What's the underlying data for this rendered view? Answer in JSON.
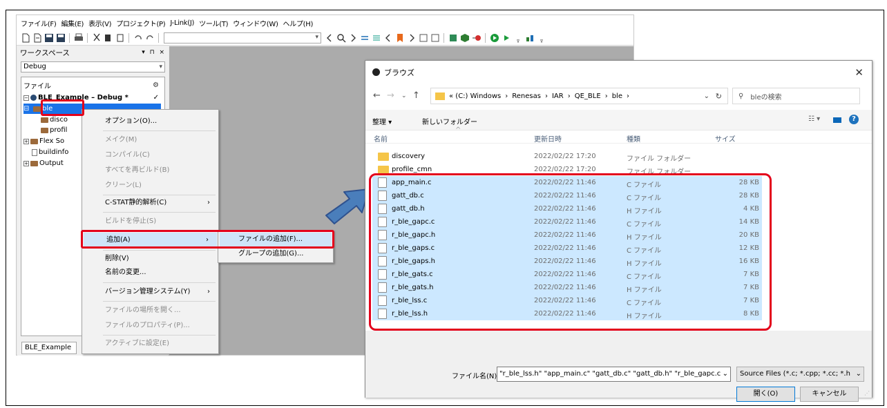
{
  "ide": {
    "menu": [
      "ファイル(F)",
      "編集(E)",
      "表示(V)",
      "プロジェクト(P)",
      "J-Link(J)",
      "ツール(T)",
      "ウィンドウ(W)",
      "ヘルプ(H)"
    ],
    "workspace": {
      "title": "ワークスペース",
      "pin_controls": "▾ ⊓ ×",
      "config": "Debug",
      "tree_header": "ファイル",
      "project": "BLE_Example – Debug *",
      "nodes": [
        "ble",
        "disco",
        "profil",
        "Flex So",
        "buildinfo",
        "Output"
      ],
      "tab": "BLE_Example"
    }
  },
  "context_menu": {
    "items": [
      "オプション(O)...",
      "メイク(M)",
      "コンパイル(C)",
      "すべてを再ビルド(B)",
      "クリーン(L)",
      "C-STAT静的解析(C)",
      "ビルドを停止(S)",
      "追加(A)",
      "削除(V)",
      "名前の変更...",
      "バージョン管理システム(Y)",
      "ファイルの場所を開く...",
      "ファイルのプロパティ(P)...",
      "アクティブに設定(E)"
    ],
    "submenu": [
      "ファイルの追加(F)...",
      "グループの追加(G)..."
    ]
  },
  "dialog": {
    "title": "ブラウズ",
    "path": [
      "« (C:) Windows",
      "Renesas",
      "IAR",
      "QE_BLE",
      "ble"
    ],
    "search_placeholder": "bleの検索",
    "organize": "整理 ▾",
    "new_folder": "新しいフォルダー",
    "columns": [
      "名前",
      "更新日時",
      "種類",
      "サイズ"
    ],
    "folders": [
      {
        "name": "discovery",
        "date": "2022/02/22 17:20",
        "type": "ファイル フォルダー"
      },
      {
        "name": "profile_cmn",
        "date": "2022/02/22 17:20",
        "type": "ファイル フォルダー"
      }
    ],
    "files": [
      {
        "name": "app_main.c",
        "date": "2022/02/22 11:46",
        "type": "C ファイル",
        "size": "28 KB"
      },
      {
        "name": "gatt_db.c",
        "date": "2022/02/22 11:46",
        "type": "C ファイル",
        "size": "28 KB"
      },
      {
        "name": "gatt_db.h",
        "date": "2022/02/22 11:46",
        "type": "H ファイル",
        "size": "4 KB"
      },
      {
        "name": "r_ble_gapc.c",
        "date": "2022/02/22 11:46",
        "type": "C ファイル",
        "size": "14 KB"
      },
      {
        "name": "r_ble_gapc.h",
        "date": "2022/02/22 11:46",
        "type": "H ファイル",
        "size": "20 KB"
      },
      {
        "name": "r_ble_gaps.c",
        "date": "2022/02/22 11:46",
        "type": "C ファイル",
        "size": "12 KB"
      },
      {
        "name": "r_ble_gaps.h",
        "date": "2022/02/22 11:46",
        "type": "H ファイル",
        "size": "16 KB"
      },
      {
        "name": "r_ble_gats.c",
        "date": "2022/02/22 11:46",
        "type": "C ファイル",
        "size": "7 KB"
      },
      {
        "name": "r_ble_gats.h",
        "date": "2022/02/22 11:46",
        "type": "H ファイル",
        "size": "7 KB"
      },
      {
        "name": "r_ble_lss.c",
        "date": "2022/02/22 11:46",
        "type": "C ファイル",
        "size": "7 KB"
      },
      {
        "name": "r_ble_lss.h",
        "date": "2022/02/22 11:46",
        "type": "H ファイル",
        "size": "8 KB"
      }
    ],
    "filename_label": "ファイル名(N):",
    "filename_value": "\"r_ble_lss.h\" \"app_main.c\" \"gatt_db.c\" \"gatt_db.h\" \"r_ble_gapc.c",
    "filetype": "Source Files (*.c; *.cpp; *.cc; *.h",
    "open": "開く(O)",
    "cancel": "キャンセル"
  },
  "colors": {
    "highlight": "#e3001b",
    "arrow": "#4a7ebb",
    "selection": "#cce8ff"
  }
}
